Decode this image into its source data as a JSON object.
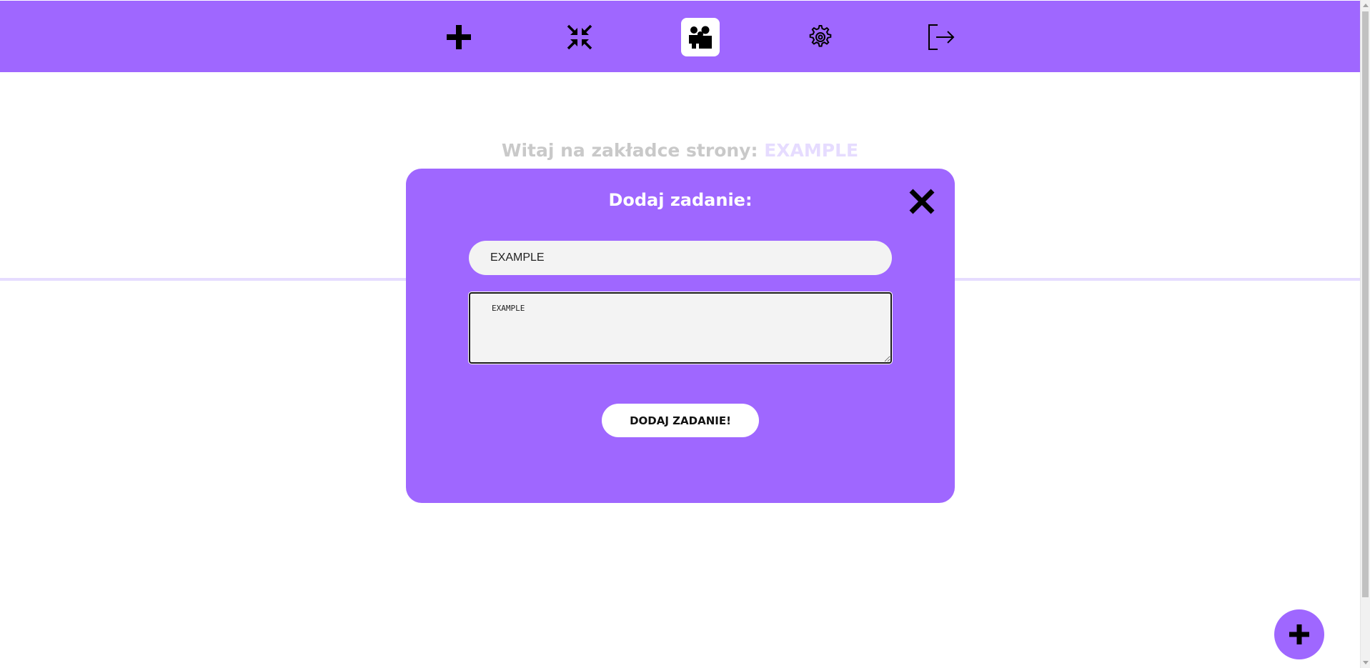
{
  "nav": {
    "items": [
      {
        "icon": "plus-icon",
        "active": false
      },
      {
        "icon": "collapse-arrows-icon",
        "active": false
      },
      {
        "icon": "users-group-icon",
        "active": true
      },
      {
        "icon": "gear-icon",
        "active": false
      },
      {
        "icon": "logout-icon",
        "active": false
      }
    ]
  },
  "welcome": {
    "prefix": "Witaj na zakładce strony: ",
    "site_name": "EXAMPLE"
  },
  "modal": {
    "title": "Dodaj zadanie:",
    "close_icon": "close-icon",
    "title_field_value": "EXAMPLE",
    "description_field_value": "EXAMPLE",
    "submit_label": "DODAJ ZADANIE!"
  },
  "fab": {
    "icon": "plus-icon"
  },
  "colors": {
    "accent": "#9f67ff",
    "accent_light": "#e6dcff",
    "field_bg": "#f3f3f3",
    "muted_text": "#c9c9c9"
  }
}
